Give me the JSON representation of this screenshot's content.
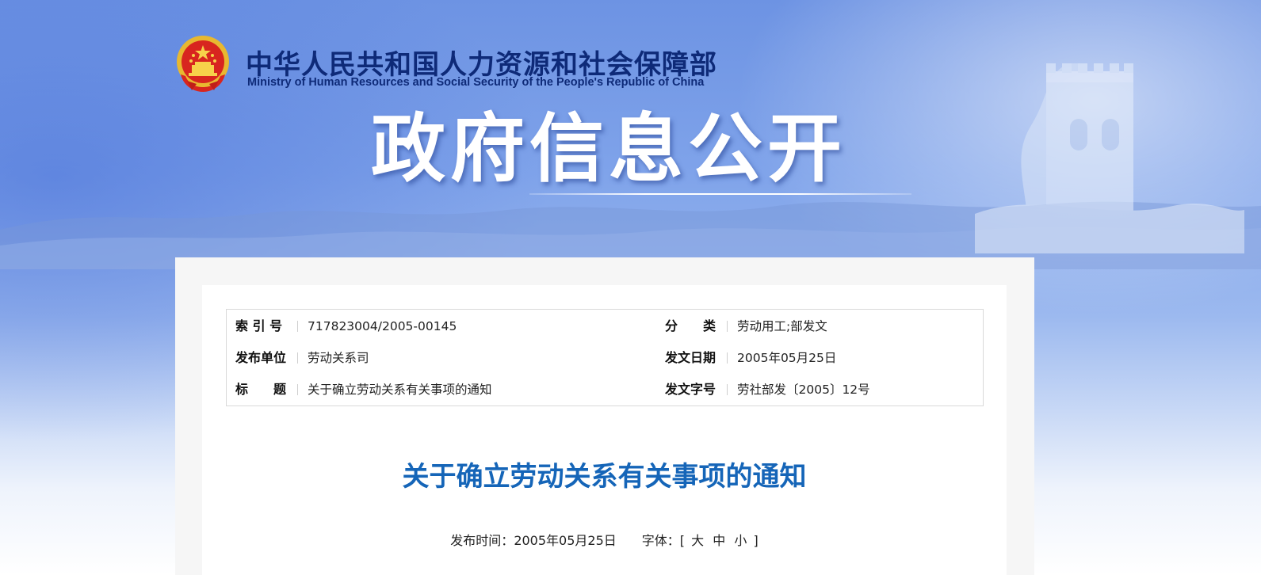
{
  "header": {
    "ministry_cn": "中华人民共和国人力资源和社会保障部",
    "ministry_en": "Ministry of Human Resources and Social Security of the People's Republic of China",
    "emblem_icon": "national-emblem-icon",
    "banner_title": "政府信息公开"
  },
  "meta": {
    "index_label": "索 引 号",
    "index_value": "717823004/2005-00145",
    "category_label": "分　　类",
    "category_value": "劳动用工;部发文",
    "publisher_label": "发布单位",
    "publisher_value": "劳动关系司",
    "date_label": "发文日期",
    "date_value": "2005年05月25日",
    "title_label": "标　　题",
    "title_value": "关于确立劳动关系有关事项的通知",
    "docno_label": "发文字号",
    "docno_value": "劳社部发〔2005〕12号"
  },
  "document": {
    "title": "关于确立劳动关系有关事项的通知",
    "publish_time_label": "发布时间：",
    "publish_time_value": "2005年05月25日",
    "font_label": "字体：",
    "font_open": "[",
    "font_large": "大",
    "font_medium": "中",
    "font_small": "小",
    "font_close": "]"
  },
  "colors": {
    "title_blue": "#1565b8",
    "ministry_navy": "#0e2a78",
    "banner_bg": "#7fa3ea"
  }
}
